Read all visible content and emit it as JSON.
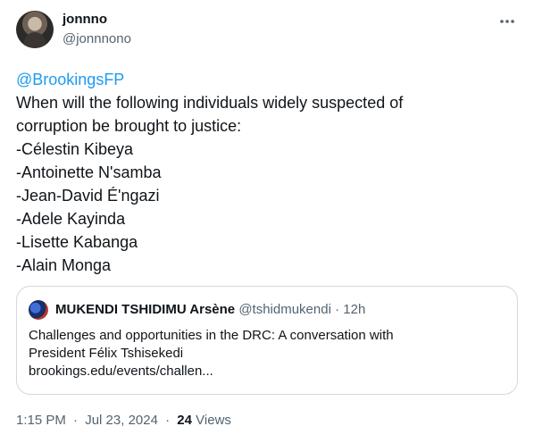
{
  "author": {
    "display_name": "jonnno",
    "handle": "@jonnnono"
  },
  "more_icon": "ellipsis-horizontal-icon",
  "tweet": {
    "mention": "@BrookingsFP",
    "lines": [
      "When will the following individuals widely suspected of",
      "corruption be brought to justice:",
      "-Célestin Kibeya",
      "-Antoinette N'samba",
      "-Jean-David É'ngazi",
      "-Adele Kayinda",
      "-Lisette Kabanga",
      "-Alain Monga"
    ]
  },
  "quote": {
    "display_name": "MUKENDI TSHIDIMU Arsène",
    "handle": "@tshidmukendi",
    "separator": "·",
    "time_ago": "12h",
    "text_lines": [
      "Challenges and opportunities in the DRC: A conversation with",
      "President Félix Tshisekedi",
      "brookings.edu/events/challen..."
    ]
  },
  "footer": {
    "time": "1:15 PM",
    "separator": "·",
    "date": "Jul 23, 2024",
    "views_count": "24",
    "views_label": "Views"
  },
  "colors": {
    "link": "#1d9bf0",
    "secondary_text": "#536471",
    "border": "#cfd9de"
  }
}
